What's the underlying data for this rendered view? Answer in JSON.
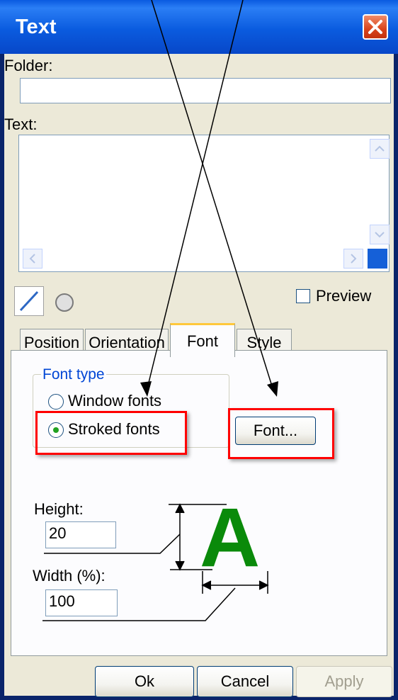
{
  "window": {
    "title": "Text"
  },
  "folder": {
    "label": "Folder:",
    "value": ""
  },
  "text": {
    "label": "Text:",
    "value": ""
  },
  "preview": {
    "label": "Preview",
    "checked": false
  },
  "tabs": [
    {
      "label": "Position"
    },
    {
      "label": "Orientation"
    },
    {
      "label": "Font"
    },
    {
      "label": "Style"
    }
  ],
  "active_tab": "Font",
  "font_type": {
    "label": "Font type",
    "options": [
      {
        "label": "Window fonts",
        "selected": false
      },
      {
        "label": "Stroked fonts",
        "selected": true
      }
    ]
  },
  "font_button": {
    "label": "Font..."
  },
  "height": {
    "label": "Height:",
    "value": "20"
  },
  "width": {
    "label": "Width (%):",
    "value": "100"
  },
  "sample": {
    "glyph": "A",
    "color": "#0a8a0a"
  },
  "buttons": {
    "ok": "Ok",
    "cancel": "Cancel",
    "apply": "Apply"
  },
  "colors": {
    "titlebar": "#0a5ae0",
    "highlight": "#ff0000",
    "group_label": "#0046d5"
  }
}
